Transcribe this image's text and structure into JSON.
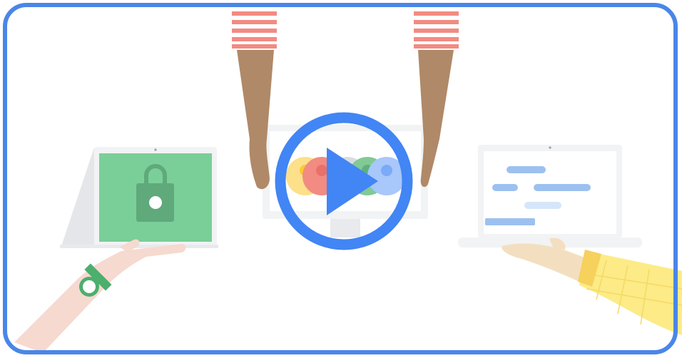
{
  "video_thumbnail": {
    "play_button": {
      "icon": "play-icon"
    },
    "colors": {
      "frame_border": "#4A86E8",
      "play_ring": "#4285F4",
      "play_triangle": "#4285F4",
      "tablet_screen": "#7ACF98",
      "lock": "#5FA97A",
      "sleeve_stripe": "#F28B82",
      "skin_dark": "#B08968",
      "skin_light": "#F6D9CF",
      "skin_tan": "#F3DFC0",
      "watch": "#4CAF6E",
      "sleeve_yellow": "#FCEB86",
      "code_line_blue": "#9CC1F0",
      "code_line_light": "#D6E6FA"
    },
    "avatars": [
      "yellow-avatar",
      "red-avatar",
      "grey-avatar",
      "green-avatar",
      "blue-avatar"
    ]
  }
}
